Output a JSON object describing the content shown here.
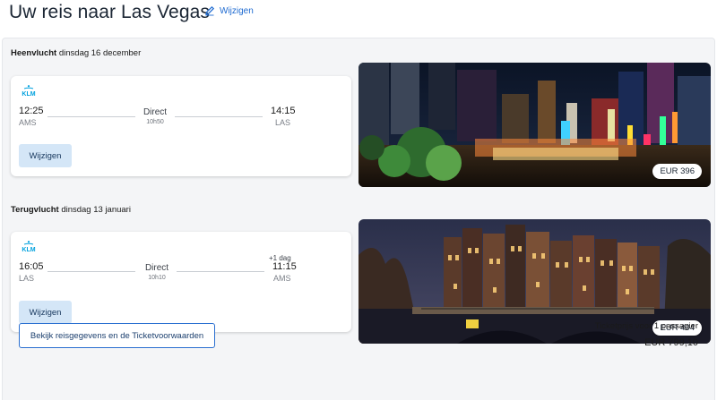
{
  "header": {
    "title": "Uw reis naar Las Vegas",
    "edit_label": "Wijzigen"
  },
  "outbound": {
    "label": "Heenvlucht",
    "date": "dinsdag 16 december",
    "airline": "KLM",
    "depart_time": "12:25",
    "depart_code": "AMS",
    "stops": "Direct",
    "duration": "10h50",
    "arrive_time": "14:15",
    "arrive_code": "LAS",
    "edit_button": "Wijzigen",
    "price": "EUR 396"
  },
  "return": {
    "label": "Terugvlucht",
    "date": "dinsdag 13 januari",
    "airline": "KLM",
    "depart_time": "16:05",
    "depart_code": "LAS",
    "stops": "Direct",
    "duration": "10h10",
    "day_offset": "+1 dag",
    "arrive_time": "11:15",
    "arrive_code": "AMS",
    "edit_button": "Wijzigen",
    "price": "EUR 404"
  },
  "footer": {
    "details_button": "Bekijk reisgegevens en de Ticketvoorwaarden",
    "total_label": "Ticketprijs voor 1 passagier",
    "total_price": "EUR 799,10"
  },
  "colors": {
    "accent": "#1f6bd1",
    "klm_blue": "#00a1de",
    "button_bg": "#d4e6f7"
  }
}
